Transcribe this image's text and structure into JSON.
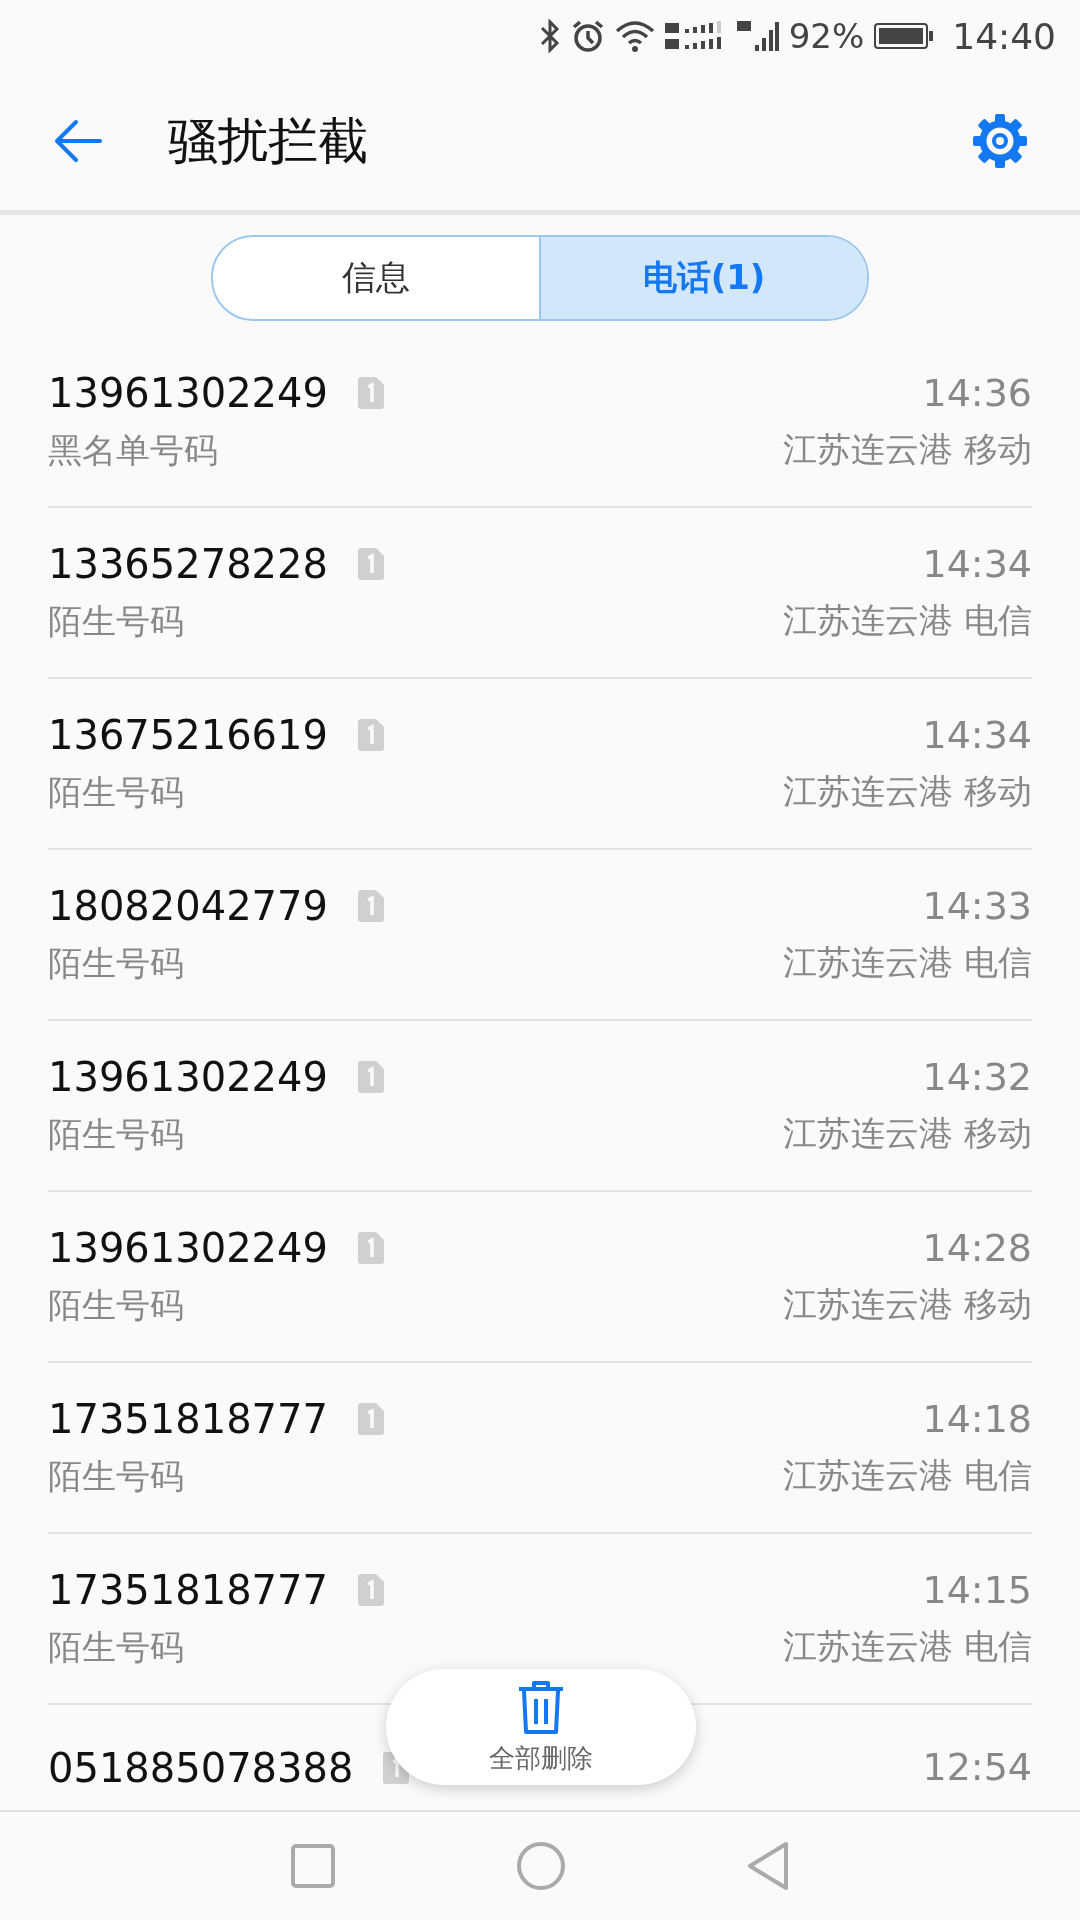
{
  "status_bar": {
    "battery": "92%",
    "time": "14:40"
  },
  "header": {
    "title": "骚扰拦截"
  },
  "tabs": [
    {
      "label": "信息",
      "selected": false
    },
    {
      "label": "电话(1)",
      "selected": true
    }
  ],
  "calls": [
    {
      "number": "13961302249",
      "label": "黑名单号码",
      "time": "14:36",
      "location": "江苏连云港 移动"
    },
    {
      "number": "13365278228",
      "label": "陌生号码",
      "time": "14:34",
      "location": "江苏连云港 电信"
    },
    {
      "number": "13675216619",
      "label": "陌生号码",
      "time": "14:34",
      "location": "江苏连云港 移动"
    },
    {
      "number": "18082042779",
      "label": "陌生号码",
      "time": "14:33",
      "location": "江苏连云港 电信"
    },
    {
      "number": "13961302249",
      "label": "陌生号码",
      "time": "14:32",
      "location": "江苏连云港 移动"
    },
    {
      "number": "13961302249",
      "label": "陌生号码",
      "time": "14:28",
      "location": "江苏连云港 移动"
    },
    {
      "number": "17351818777",
      "label": "陌生号码",
      "time": "14:18",
      "location": "江苏连云港 电信"
    },
    {
      "number": "17351818777",
      "label": "陌生号码",
      "time": "14:15",
      "location": "江苏连云港 电信"
    },
    {
      "number": "051885078388",
      "time": "12:54"
    }
  ],
  "delete_all": {
    "label": "全部删除"
  }
}
